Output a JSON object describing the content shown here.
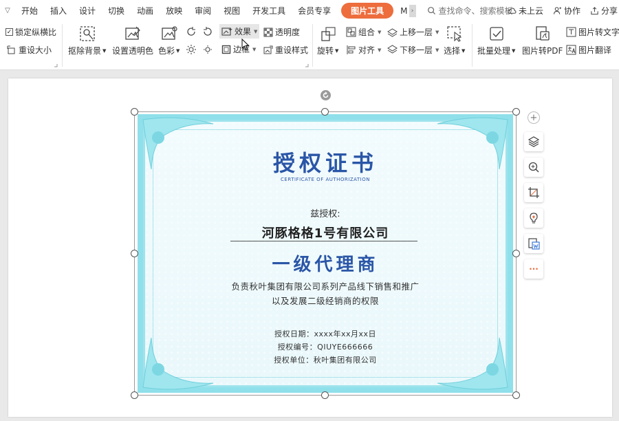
{
  "menubar": {
    "items": [
      "开始",
      "插入",
      "设计",
      "切换",
      "动画",
      "放映",
      "审阅",
      "视图",
      "开发工具",
      "会员专享"
    ],
    "context_tab": "图片工具",
    "truncated_tab": "M",
    "search_placeholder": "查找命令、搜索模板",
    "cloud_status": "未上云",
    "collaborate": "协作",
    "share": "分享"
  },
  "ribbon": {
    "lock_ratio": "锁定纵横比",
    "reset_size": "重设大小",
    "remove_bg": "抠除背景",
    "set_transparent": "设置透明色",
    "color": "色彩",
    "effects": "效果",
    "transparency": "透明度",
    "border": "边框",
    "reset_style": "重设样式",
    "rotate": "旋转",
    "group": "组合",
    "align": "对齐",
    "bring_forward": "上移一层",
    "send_backward": "下移一层",
    "select": "选择",
    "batch_process": "批量处理",
    "pic_to_pdf": "图片转PDF",
    "pic_to_text": "图片转文字",
    "pic_translate": "图片翻译"
  },
  "certificate": {
    "title": "授权证书",
    "subtitle": "CERTIFICATE OF AUTHORIZATION",
    "hereby": "兹授权:",
    "company": "河豚格格1号有限公司",
    "role": "一级代理商",
    "desc_line1": "负责秋叶集团有限公司系列产品线下销售和推广",
    "desc_line2": "以及发展二级经销商的权限",
    "meta_date": "授权日期：xxxx年xx月xx日",
    "meta_number": "授权编号：QIUYE666666",
    "meta_unit": "授权单位：秋叶集团有限公司"
  },
  "float_toolbar": {
    "more": "···"
  },
  "colors": {
    "accent": "#ed6d3d",
    "cert_blue": "#2a56a7",
    "cert_teal": "#8fe0ea"
  }
}
